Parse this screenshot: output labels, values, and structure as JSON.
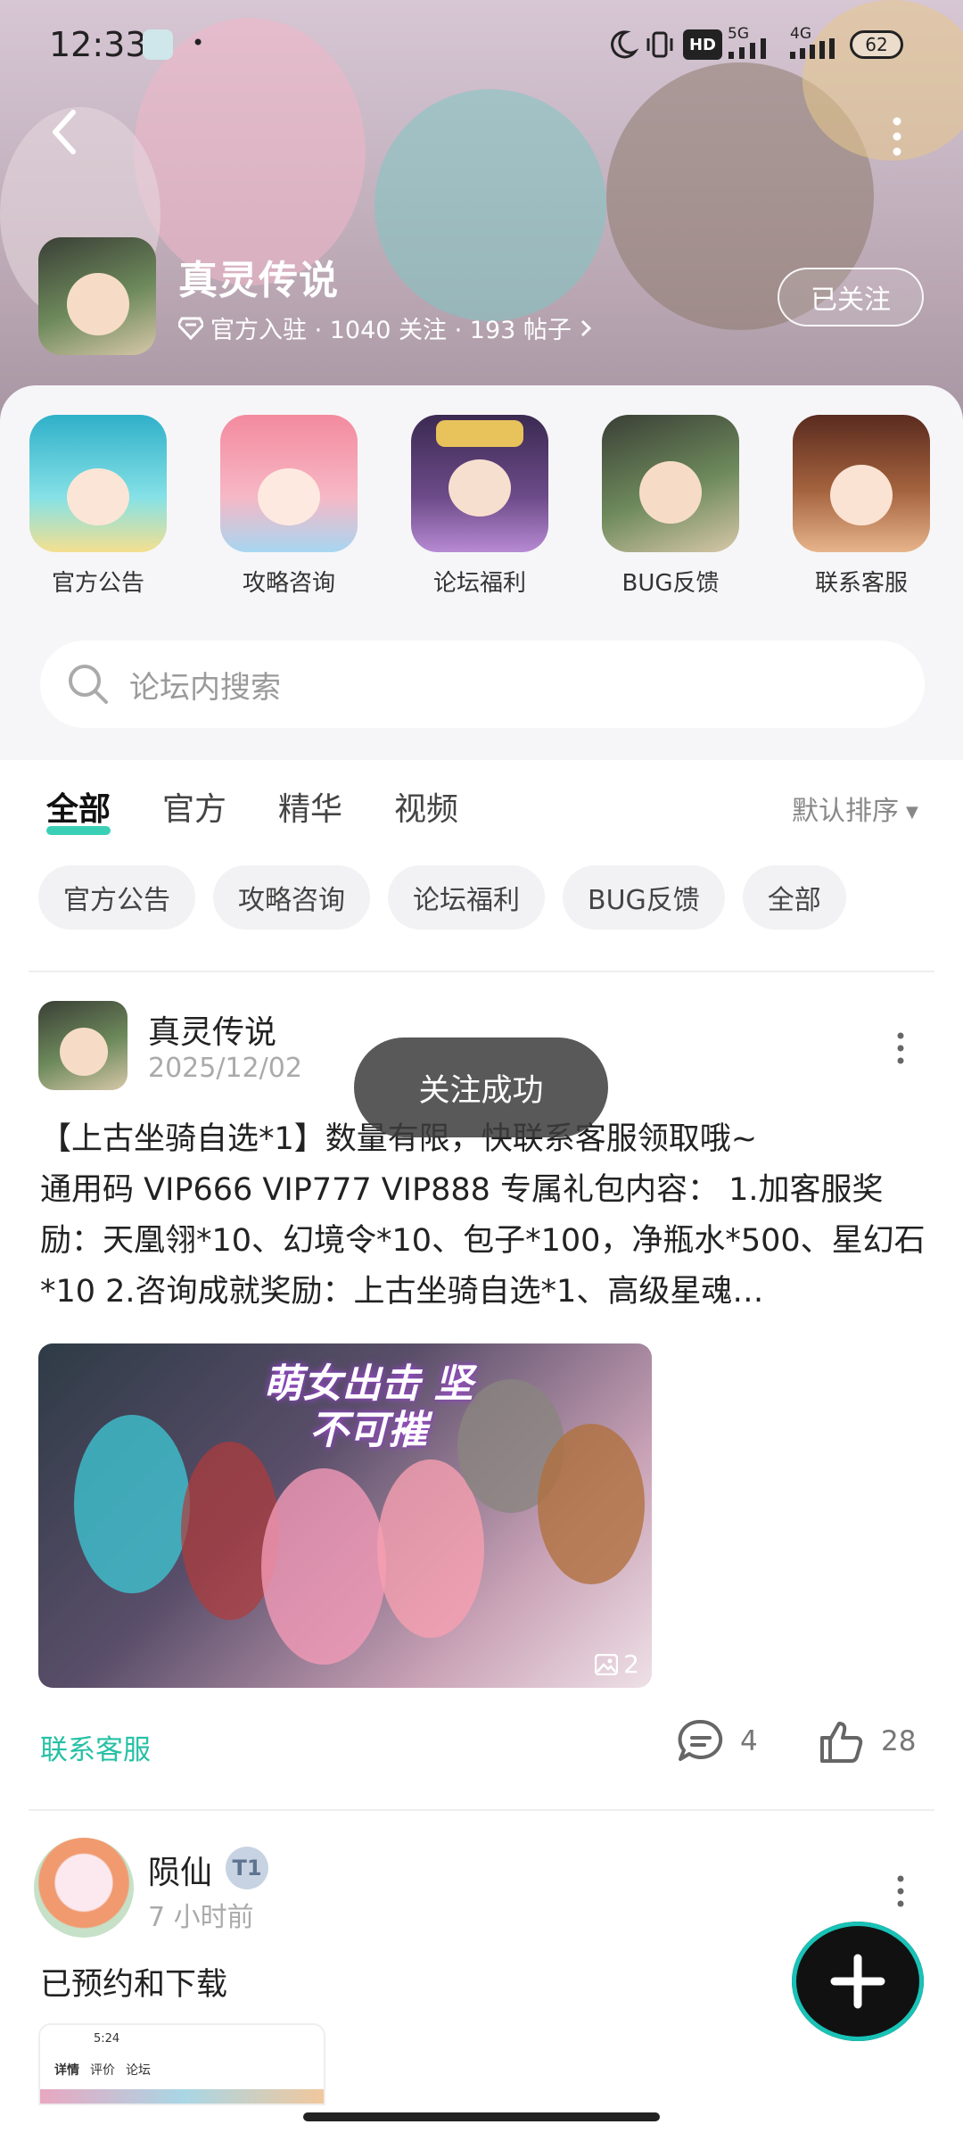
{
  "status_bar": {
    "time": "12:33",
    "battery": "62",
    "net1": "5G",
    "net2": "4G",
    "hd": "HD"
  },
  "header": {
    "title": "真灵传说",
    "meta": "官方入驻 · 1040 关注 · 193 帖子",
    "follow_label": "已关注"
  },
  "categories": [
    {
      "label": "官方公告",
      "icon": "character-blue-hair"
    },
    {
      "label": "攻略咨询",
      "icon": "character-pink-hair"
    },
    {
      "label": "论坛福利",
      "icon": "character-crown"
    },
    {
      "label": "BUG反馈",
      "icon": "character-green"
    },
    {
      "label": "联系客服",
      "icon": "character-cat-ears"
    }
  ],
  "search": {
    "placeholder": "论坛内搜索"
  },
  "tabs": [
    {
      "label": "全部",
      "active": true
    },
    {
      "label": "官方",
      "active": false
    },
    {
      "label": "精华",
      "active": false
    },
    {
      "label": "视频",
      "active": false
    }
  ],
  "sort_label": "默认排序",
  "chips": [
    "官方公告",
    "攻略咨询",
    "论坛福利",
    "BUG反馈",
    "全部"
  ],
  "post1": {
    "author": "真灵传说",
    "date": "2025/12/02",
    "title": "【上古坐骑自选*1】数量有限，快联系客服领取哦~",
    "body": "通用码 VIP666 VIP777 VIP888 专属礼包内容： 1.加客服奖励：天凰翎*10、幻境令*10、包子*100，净瓶水*500、星幻石*10 2.咨询成就奖励：上古坐骑自选*1、高级星魂…",
    "image_count": "2",
    "tag": "联系客服",
    "comments": "4",
    "likes": "28",
    "banner_text": "萌女出击 坚不可摧"
  },
  "toast": "关注成功",
  "post2": {
    "author": "陨仙",
    "badge": "T1",
    "time": "7 小时前",
    "text": "已预约和下载",
    "thumb_time": "5:24",
    "thumb_tabs": [
      "详情",
      "评价",
      "论坛"
    ]
  },
  "colors": {
    "accent": "#27c0a5",
    "tab_underline": "#3ad0b5"
  }
}
